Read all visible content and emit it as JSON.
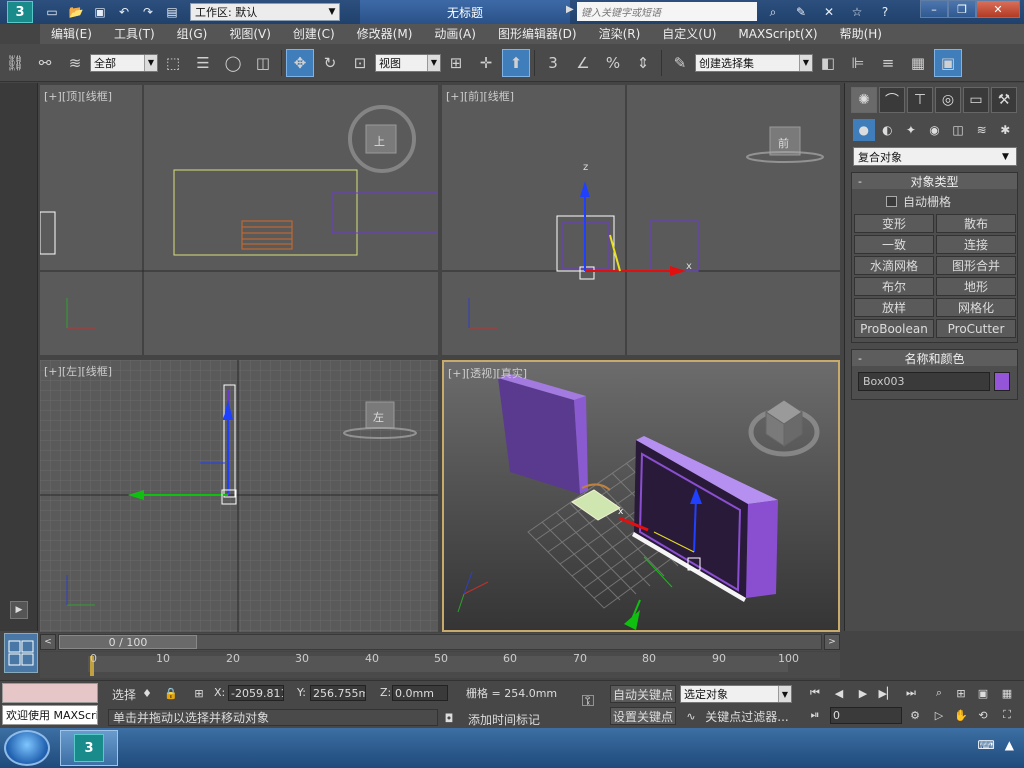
{
  "titlebar": {
    "workspace_label": "工作区: 默认",
    "window_title": "无标题",
    "search_placeholder": "键入关键字或短语",
    "logo_text": "3"
  },
  "menu": [
    "编辑(E)",
    "工具(T)",
    "组(G)",
    "视图(V)",
    "创建(C)",
    "修改器(M)",
    "动画(A)",
    "图形编辑器(D)",
    "渲染(R)",
    "自定义(U)",
    "MAXScript(X)",
    "帮助(H)"
  ],
  "toolbar": {
    "filter_value": "全部",
    "refcoord_value": "视图",
    "selection_set_value": "创建选择集",
    "snap_label": "3"
  },
  "viewports": {
    "top": {
      "label_plus": "[+]",
      "label_view": "[顶]",
      "label_shade": "[线框]",
      "cube_label": "上"
    },
    "front": {
      "label_plus": "[+]",
      "label_view": "[前]",
      "label_shade": "[线框]",
      "cube_label": "前"
    },
    "left": {
      "label_plus": "[+]",
      "label_view": "[左]",
      "label_shade": "[线框]",
      "cube_label": "左"
    },
    "persp": {
      "label_plus": "[+]",
      "label_view": "[透视]",
      "label_shade": "[真实]"
    }
  },
  "command_panel": {
    "category_value": "复合对象",
    "object_type_title": "对象类型",
    "autogrid_label": "自动栅格",
    "buttons": [
      "变形",
      "散布",
      "一致",
      "连接",
      "水滴网格",
      "图形合并",
      "布尔",
      "地形",
      "放样",
      "网格化",
      "ProBoolean",
      "ProCutter"
    ],
    "name_color_title": "名称和颜色",
    "object_name": "Box003",
    "object_color": "#9455d8"
  },
  "timeline": {
    "frame_display": "0 / 100",
    "ruler_ticks": [
      "0",
      "10",
      "20",
      "30",
      "40",
      "50",
      "60",
      "70",
      "80",
      "90",
      "100"
    ]
  },
  "status": {
    "maxscript_output": "欢迎使用 MAXScri",
    "selection_label": "选择",
    "x_label": "X:",
    "x_value": "-2059.811i",
    "y_label": "Y:",
    "y_value": "256.755mr",
    "z_label": "Z:",
    "z_value": "0.0mm",
    "grid_label": "栅格 = 254.0mm",
    "prompt": "单击并拖动以选择并移动对象",
    "add_time_tag": "添加时间标记",
    "auto_key": "自动关键点",
    "set_key": "设置关键点",
    "key_mode_value": "选定对象",
    "key_filters": "关键点过滤器...",
    "current_frame": "0"
  },
  "colors": {
    "accent": "#3f7ebb",
    "active_viewport_border": "#c8aa6b",
    "object_purple": "#8a4fd0"
  }
}
